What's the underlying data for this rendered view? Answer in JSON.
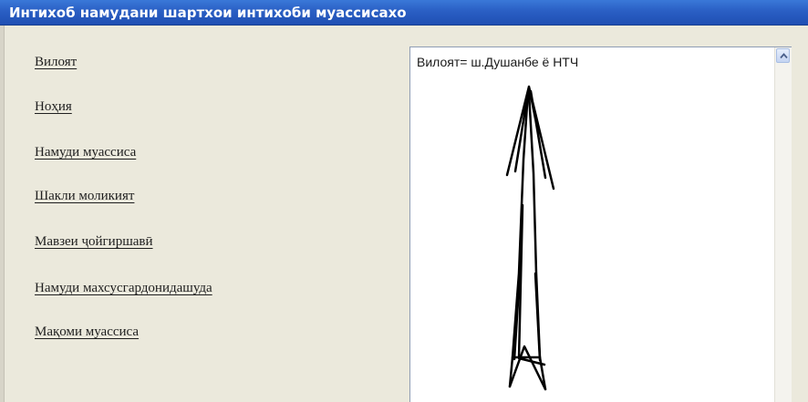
{
  "window": {
    "title": "Интихоб намудани шартхои интихоби муассисахо"
  },
  "criteria": [
    {
      "label": "Вилоят"
    },
    {
      "label": "Ноҳия"
    },
    {
      "label": "Намуди муассиса"
    },
    {
      "label": "Шакли моликият"
    },
    {
      "label": "Мавзеи ҷойгиршавӣ"
    },
    {
      "label": "Намуди махсусгардонидашуда"
    },
    {
      "label": "Мақоми муассиса"
    }
  ],
  "result": {
    "text": "Вилоят= ш.Душанбе ё НТЧ"
  },
  "icons": {
    "scroll_up": "scroll-up-arrow-icon",
    "annotation": "hand-drawn-arrow-icon"
  },
  "colors": {
    "title_bar": "#2a5fc4",
    "panel_background": "#ebe9dc",
    "result_border": "#8f9db5"
  }
}
